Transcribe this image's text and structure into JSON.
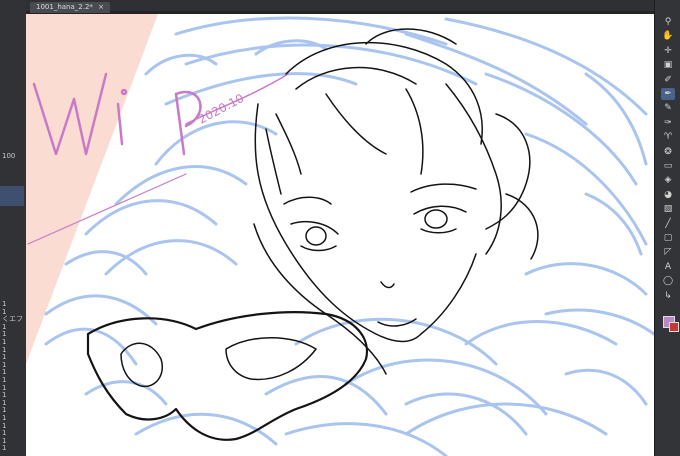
{
  "document": {
    "tab_label": "1001_hana_2.2*",
    "tab_close": "×"
  },
  "artwork": {
    "signature": "Wip 2020.10.10"
  },
  "left_panel": {
    "zoom_value": "100",
    "rows": [
      "1",
      "1",
      "くエフ",
      "1",
      "1",
      "1",
      "1",
      "1",
      "1",
      "1",
      "1",
      "1",
      "1",
      "1",
      "1",
      "1",
      "1",
      "1",
      "1",
      "1"
    ]
  },
  "toolbar": {
    "tools": [
      {
        "name": "zoom-tool-icon",
        "glyph": "⚲"
      },
      {
        "name": "hand-tool-icon",
        "glyph": "✋"
      },
      {
        "name": "move-layer-icon",
        "glyph": "✛"
      },
      {
        "name": "operation-tool-icon",
        "glyph": "▣"
      },
      {
        "name": "eyedropper-icon",
        "glyph": "✐"
      },
      {
        "name": "pen-tool-icon",
        "glyph": "✒"
      },
      {
        "name": "pencil-tool-icon",
        "glyph": "✎"
      },
      {
        "name": "brush-tool-icon",
        "glyph": "✑"
      },
      {
        "name": "airbrush-tool-icon",
        "glyph": "♈"
      },
      {
        "name": "decoration-tool-icon",
        "glyph": "❂"
      },
      {
        "name": "eraser-tool-icon",
        "glyph": "▭"
      },
      {
        "name": "blend-tool-icon",
        "glyph": "◈"
      },
      {
        "name": "fill-tool-icon",
        "glyph": "◕"
      },
      {
        "name": "gradient-tool-icon",
        "glyph": "▧"
      },
      {
        "name": "figure-tool-icon",
        "glyph": "╱"
      },
      {
        "name": "frame-tool-icon",
        "glyph": "▢"
      },
      {
        "name": "ruler-tool-icon",
        "glyph": "◸"
      },
      {
        "name": "text-tool-icon",
        "glyph": "A"
      },
      {
        "name": "balloon-tool-icon",
        "glyph": "◯"
      },
      {
        "name": "correct-line-tool-icon",
        "glyph": "↳"
      }
    ],
    "active_index": 5,
    "main_color": "#b889c5",
    "sub_color": "#c23a36"
  },
  "colors": {
    "sketch_blue": "#a9c4ee",
    "peach_bg": "#fbdcd3",
    "line_dark": "#141414",
    "signature_purple": "#c97ac7"
  }
}
